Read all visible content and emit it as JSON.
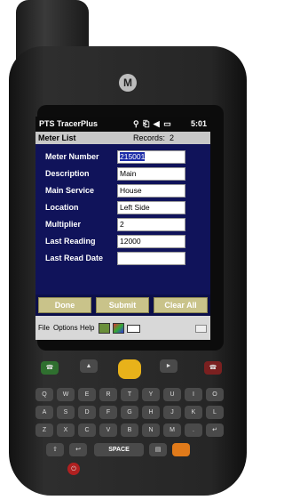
{
  "device": {
    "brand_logo": "M"
  },
  "status_bar": {
    "app_name": "PTS TracerPlus",
    "icons": "⚲ ⎗ ◀ ▭",
    "time": "5:01"
  },
  "header": {
    "title": "Meter List",
    "records_label": "Records:",
    "records_count": "2"
  },
  "form": {
    "fields": [
      {
        "label": "Meter Number",
        "value": "215001"
      },
      {
        "label": "Description",
        "value": "Main"
      },
      {
        "label": "Main Service",
        "value": "House"
      },
      {
        "label": "Location",
        "value": "Left Side"
      },
      {
        "label": "Multiplier",
        "value": "2"
      },
      {
        "label": "Last Reading",
        "value": "12000"
      },
      {
        "label": "Last Read Date",
        "value": ""
      }
    ]
  },
  "buttons": {
    "done": "Done",
    "submit": "Submit",
    "clear_all": "Clear All"
  },
  "menubar": {
    "file": "File",
    "options": "Options",
    "help": "Help"
  },
  "keypad": {
    "space": "SPACE"
  }
}
